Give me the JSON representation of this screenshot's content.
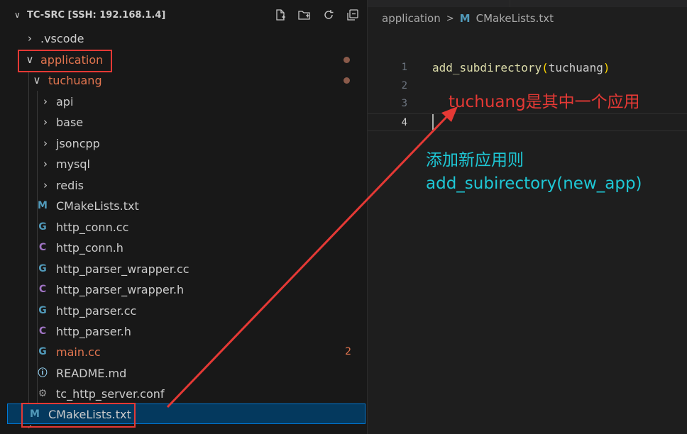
{
  "explorer": {
    "title": "TC-SRC [SSH: 192.168.1.4]",
    "actions": [
      "new-file-icon",
      "new-folder-icon",
      "refresh-icon",
      "collapse-all-icon"
    ],
    "items": [
      {
        "label": ".vscode",
        "kind": "folder",
        "expanded": false
      },
      {
        "label": "application",
        "kind": "folder",
        "expanded": true,
        "modified": true
      },
      {
        "label": "tuchuang",
        "kind": "folder",
        "expanded": true,
        "modified": true
      },
      {
        "label": "api",
        "kind": "folder",
        "expanded": false
      },
      {
        "label": "base",
        "kind": "folder",
        "expanded": false
      },
      {
        "label": "jsoncpp",
        "kind": "folder",
        "expanded": false
      },
      {
        "label": "mysql",
        "kind": "folder",
        "expanded": false
      },
      {
        "label": "redis",
        "kind": "folder",
        "expanded": false
      },
      {
        "label": "CMakeLists.txt",
        "kind": "cmake-file"
      },
      {
        "label": "http_conn.cc",
        "kind": "cpp-file"
      },
      {
        "label": "http_conn.h",
        "kind": "c-header-file"
      },
      {
        "label": "http_parser_wrapper.cc",
        "kind": "cpp-file"
      },
      {
        "label": "http_parser_wrapper.h",
        "kind": "c-header-file"
      },
      {
        "label": "http_parser.cc",
        "kind": "cpp-file"
      },
      {
        "label": "http_parser.h",
        "kind": "c-header-file"
      },
      {
        "label": "main.cc",
        "kind": "cpp-file",
        "modified": true,
        "problems": "2"
      },
      {
        "label": "README.md",
        "kind": "info-file"
      },
      {
        "label": "tc_http_server.conf",
        "kind": "gear-file"
      },
      {
        "label": "CMakeLists.txt",
        "kind": "cmake-file",
        "selected": true
      }
    ]
  },
  "breadcrumb": {
    "folder": "application",
    "separator": ">",
    "file": "CMakeLists.txt"
  },
  "editor": {
    "lines": [
      {
        "num": "1",
        "func": "add_subdirectory",
        "open": "(",
        "arg": "tuchuang",
        "close": ")"
      },
      {
        "num": "2"
      },
      {
        "num": "3"
      },
      {
        "num": "4",
        "active": true
      }
    ]
  },
  "annotations": {
    "red_note": "tuchuang是其中一个应用",
    "cyan_note_line1": "添加新应用则",
    "cyan_note_line2": "add_subirectory(new_app)"
  },
  "colors": {
    "annotation_red": "#e53935",
    "annotation_cyan": "#1ec8d6",
    "function_yellow": "#dcdcaa",
    "bracket_gold": "#ffd700",
    "text_default": "#cccccc",
    "git_modified": "#e2754f",
    "selection_bg": "#04395e"
  }
}
